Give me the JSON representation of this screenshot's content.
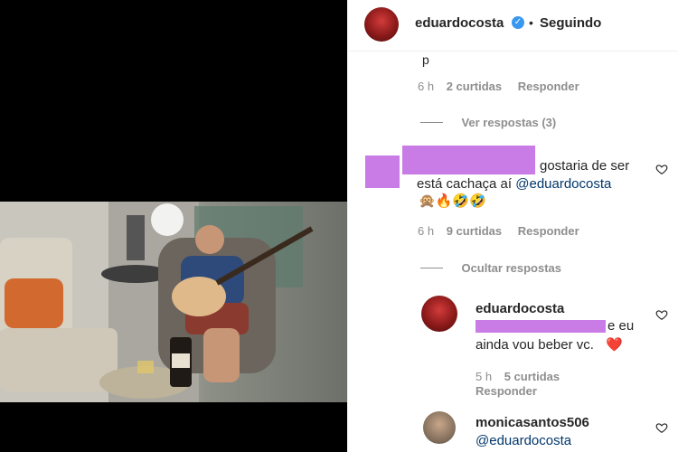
{
  "header": {
    "username": "eduardocosta",
    "separator": "•",
    "follow_status": "Seguindo"
  },
  "comment0": {
    "time": "6 h",
    "likes": "2 curtidas",
    "reply": "Responder"
  },
  "view_replies": "Ver respostas (3)",
  "comment1": {
    "text": "gostaria de ser está cachaça aí",
    "mention": "@eduardocosta",
    "emojis": "🙊🔥🤣🤣",
    "time": "6 h",
    "likes": "9 curtidas",
    "reply": "Responder"
  },
  "hide_replies": "Ocultar respostas",
  "reply1": {
    "username": "eduardocosta",
    "text_tail": "e eu",
    "text_line2": "ainda vou beber vc.",
    "emoji": "❤️",
    "time": "5 h",
    "likes": "5 curtidas",
    "reply": "Responder"
  },
  "comment2": {
    "username": "monicasantos506",
    "mention": "@eduardocosta"
  },
  "colors": {
    "redaction": "#c97ce6",
    "verified": "#3897f0",
    "link": "#00376b",
    "muted": "#8e8e8e"
  }
}
